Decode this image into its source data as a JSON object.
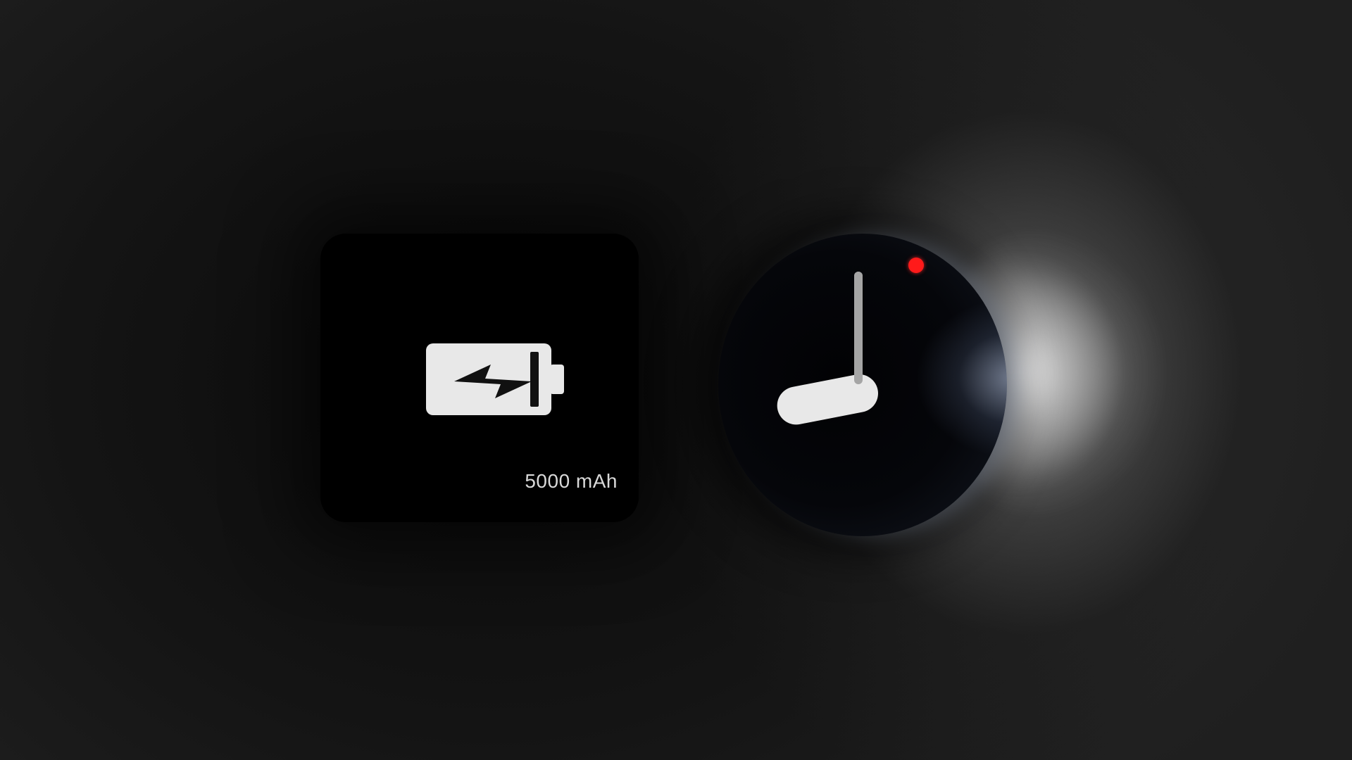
{
  "battery": {
    "icon": "battery-charging-icon",
    "capacity_label": "5000 mAh"
  },
  "clock": {
    "icon": "clock-icon",
    "time_shown": "9:00",
    "second_marker_color": "#ff1a1a"
  },
  "colors": {
    "background": "#141414",
    "card": "#000000",
    "battery_fill": "#e8e8e8",
    "hour_hand": "#e8e8e8",
    "minute_hand": "#9d9d9d",
    "glow": "#ffffff"
  }
}
